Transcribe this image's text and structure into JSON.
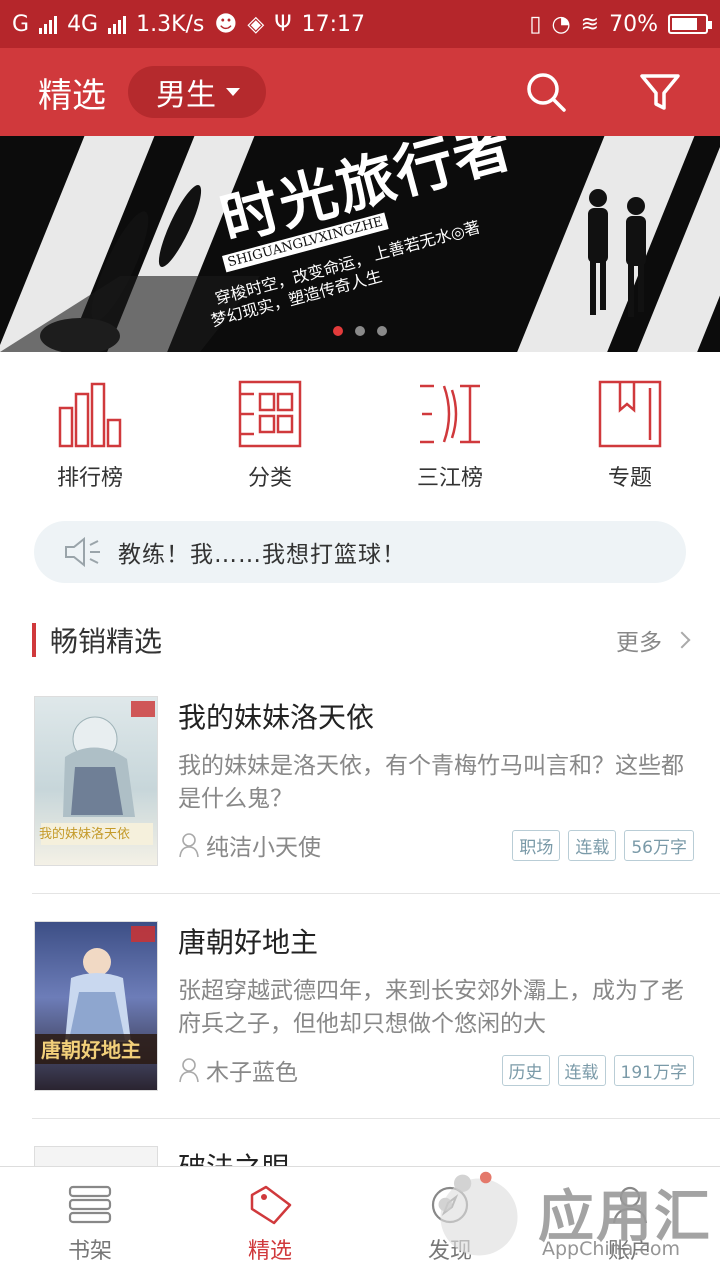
{
  "status_bar": {
    "network_1": "G",
    "network_2": "4G",
    "speed": "1.3K/s",
    "time": "17:17",
    "battery": "70%"
  },
  "header": {
    "title": "精选",
    "gender_selector": "男生"
  },
  "banner": {
    "title": "时光旅行者",
    "pinyin": "SHIGUANGLVXINGZHE",
    "author_line": "上善若无水◎著",
    "tagline_1": "穿梭时空，改变命运，",
    "tagline_2": "梦幻现实，塑造传奇人生",
    "active_dot": 0,
    "dot_count": 3
  },
  "quick_nav": [
    {
      "label": "排行榜",
      "icon": "bar-chart-icon"
    },
    {
      "label": "分类",
      "icon": "grid-icon"
    },
    {
      "label": "三江榜",
      "icon": "sanjiang-icon"
    },
    {
      "label": "专题",
      "icon": "bookmark-icon"
    }
  ],
  "notice": {
    "text": "教练！我……我想打篮球！"
  },
  "section": {
    "title": "畅销精选",
    "more": "更多"
  },
  "books": [
    {
      "title": "我的妹妹洛天依",
      "desc": "我的妹妹是洛天依，有个青梅竹马叫言和？这些都是什么鬼？",
      "author": "纯洁小天使",
      "tags": [
        "职场",
        "连载",
        "56万字"
      ],
      "cover_text": "我的妹妹洛天依"
    },
    {
      "title": "唐朝好地主",
      "desc": "张超穿越武德四年，来到长安郊外灞上，成为了老府兵之子，但他却只想做个悠闲的大",
      "author": "木子蓝色",
      "tags": [
        "历史",
        "连载",
        "191万字"
      ],
      "cover_text": "唐朝好地主"
    },
    {
      "title": "破法之眼"
    }
  ],
  "bottom_nav": [
    {
      "label": "书架",
      "icon": "bookshelf-icon"
    },
    {
      "label": "精选",
      "icon": "tag-icon",
      "active": true
    },
    {
      "label": "发现",
      "icon": "compass-icon"
    },
    {
      "label": "账户",
      "icon": "account-icon"
    }
  ],
  "watermark": {
    "text": "应用汇",
    "sub": "AppChina.com"
  },
  "colors": {
    "brand_red": "#d0393c",
    "status_bar": "#b5262b",
    "pill": "#b52a2d"
  }
}
